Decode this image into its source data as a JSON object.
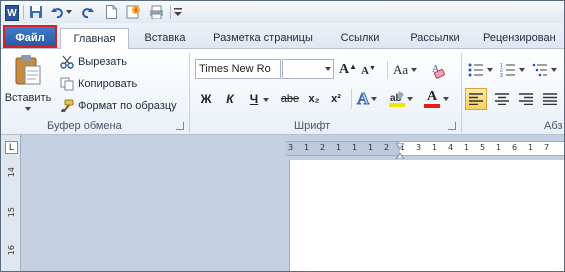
{
  "qat": {
    "app_icon_letter": "W",
    "icons": [
      "save-icon",
      "undo-icon",
      "undo-dropdown-icon",
      "redo-icon",
      "new-document-icon",
      "quick-print-icon",
      "print-preview-icon",
      "customize-qat-icon"
    ]
  },
  "tabs": {
    "file": "Файл",
    "home": "Главная",
    "insert": "Вставка",
    "page_layout": "Разметка страницы",
    "references": "Ссылки",
    "mailings": "Рассылки",
    "review": "Рецензирован"
  },
  "clipboard": {
    "paste": "Вставить",
    "cut": "Вырезать",
    "copy": "Копировать",
    "format_painter": "Формат по образцу",
    "group_label": "Буфер обмена"
  },
  "font": {
    "font_name": "Times New Ro",
    "font_size": "",
    "grow": "A",
    "shrink": "A",
    "change_case": "Aa",
    "clear_format": "A",
    "bold": "Ж",
    "italic": "К",
    "underline": "Ч",
    "strikethrough": "abe",
    "subscript": "x₂",
    "superscript": "x²",
    "text_effects": "A",
    "font_color": "A",
    "group_label": "Шрифт"
  },
  "paragraph": {
    "group_label": "Абз"
  },
  "ruler": {
    "corner": "L",
    "horizontal_numbers": [
      "3",
      "1",
      "2",
      "1",
      "1",
      "1",
      "2",
      "1",
      "3",
      "1",
      "4",
      "1",
      "5",
      "1",
      "6",
      "1",
      "7"
    ],
    "vertical_numbers": [
      "14",
      "15",
      "16"
    ]
  },
  "colors": {
    "file_tab": "#2a5aa3",
    "file_tab_highlight": "#d5202a",
    "ribbon_bg": "#eaf0f8",
    "doc_bg": "#c4d0e1",
    "font_color_bar": "#e0201c",
    "highlight_bar": "#f2e600"
  }
}
